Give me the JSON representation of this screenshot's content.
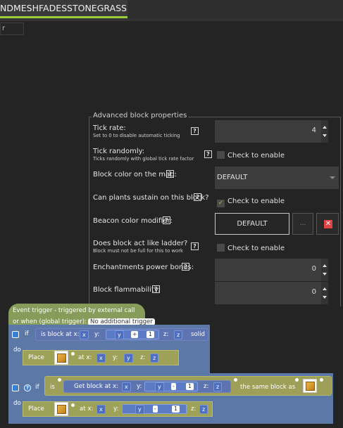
{
  "tab": {
    "title": "NDMESHFADESSTONEGRASS",
    "close": "×"
  },
  "search": {
    "value": "r"
  },
  "panel": {
    "legend": "Advanced block properties",
    "tick_rate": {
      "label": "Tick rate:",
      "sub": "Set to 0 to disable automatic ticking",
      "value": "4"
    },
    "tick_randomly": {
      "label": "Tick randomly:",
      "sub": "Ticks randomly with global tick rate factor",
      "check_label": "Check to enable"
    },
    "map_color": {
      "label": "Block color on the map:",
      "value": "DEFAULT"
    },
    "plants_sustain": {
      "label": "Can plants sustain on this block?",
      "check_label": "Check to enable",
      "check_mark": "✓"
    },
    "beacon": {
      "label": "Beacon color modifier:",
      "value": "DEFAULT",
      "dots": "...",
      "x": "✕"
    },
    "ladder": {
      "label": "Does block act like ladder?",
      "sub": "Block must not be full for this to work",
      "check_label": "Check to enable"
    },
    "enchant": {
      "label": "Enchantments power bonus:",
      "value": "0"
    },
    "flammability": {
      "label": "Block flammability:",
      "value": "0"
    },
    "help": "?"
  },
  "blocks": {
    "event_line1": "Event trigger - triggered by external call",
    "event_line2": "or when (global trigger):",
    "event_trigger": "No additional trigger",
    "if1": {
      "if": "if",
      "do": "do",
      "cond": "is block at x:",
      "x": "x",
      "y_label": "y:",
      "y": "y",
      "op": "+",
      "num": "1",
      "z_label": "z:",
      "z": "z",
      "suffix": "solid",
      "place": "Place",
      "at_x": "at x:",
      "px": "x",
      "py_label": "y:",
      "py": "y",
      "pz_label": "z:",
      "pz": "z"
    },
    "if2": {
      "if": "if",
      "not": "?",
      "is": "is",
      "get": "Get block at x:",
      "x": "x",
      "y_label": "y:",
      "y": "y",
      "op": "-",
      "num": "1",
      "z_label": "z:",
      "z": "z",
      "same": "the same block as",
      "do": "do",
      "place": "Place",
      "at_x": "at x:",
      "px": "x",
      "py_label": "y:",
      "py": "y",
      "pop": "-",
      "pnum": "1",
      "pz_label": "z:",
      "pz": "z"
    }
  },
  "colors": {
    "accent": "#9acd3a",
    "event_block": "#879c5a",
    "if_block": "#5b78a6",
    "place_block": "#9ea158"
  }
}
